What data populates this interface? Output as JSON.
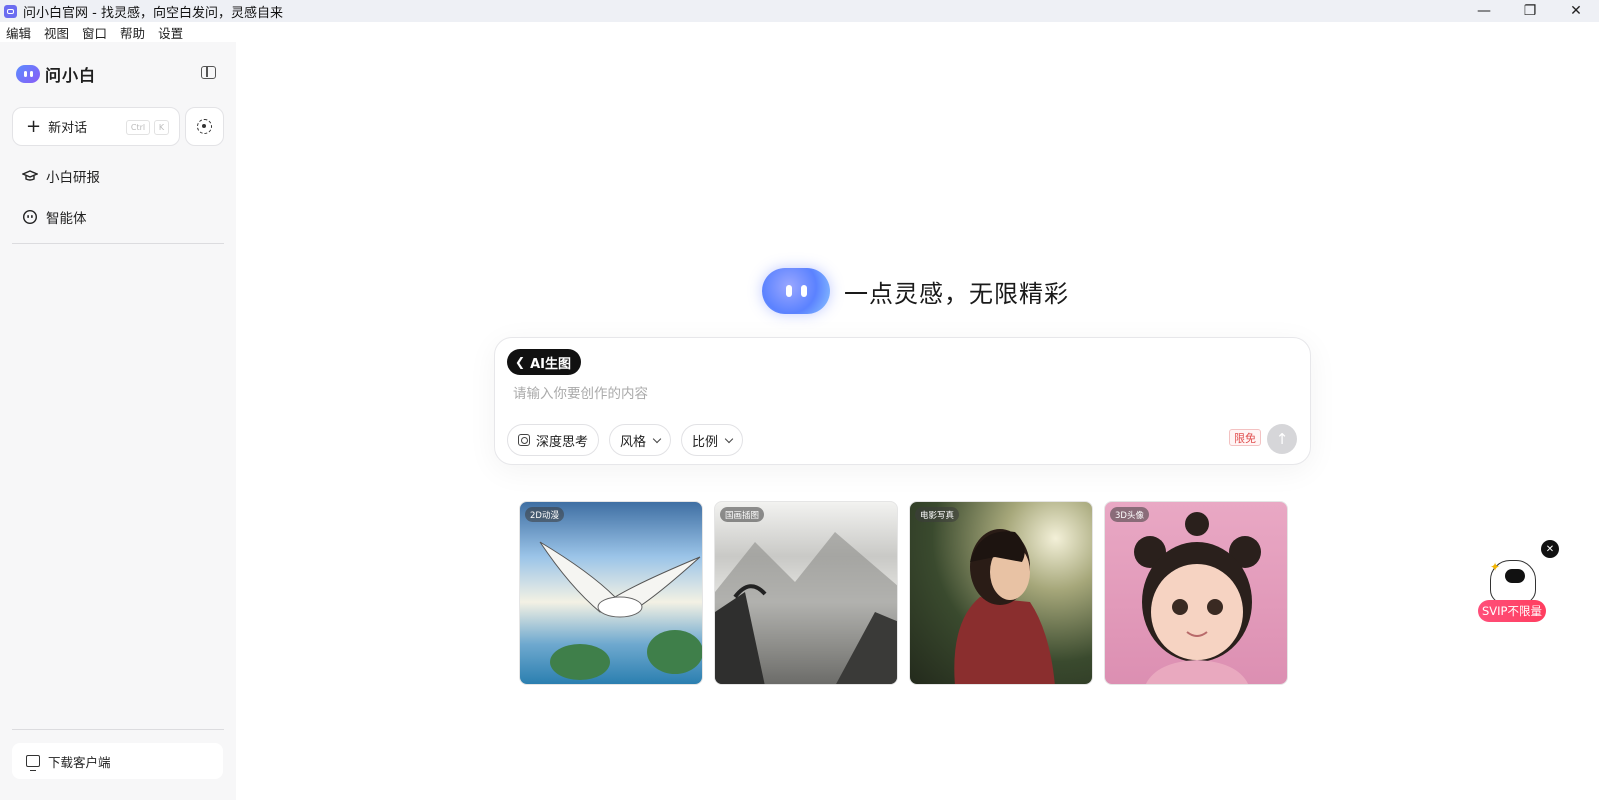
{
  "window": {
    "title": "问小白官网 - 找灵感，向空白发问，灵感自来",
    "controls": {
      "minimize": "—",
      "restore": "❐",
      "close": "✕"
    }
  },
  "menu": [
    "编辑",
    "视图",
    "窗口",
    "帮助",
    "设置"
  ],
  "sidebar": {
    "brand": "问小白",
    "new_chat": {
      "label": "新对话",
      "shortcut_ctrl": "Ctrl",
      "shortcut_key": "K"
    },
    "items": [
      {
        "label": "小白研报",
        "icon": "graduation-cap-icon"
      },
      {
        "label": "智能体",
        "icon": "bot-face-icon"
      }
    ],
    "download": "下载客户端"
  },
  "hero": {
    "slogan": "一点灵感，无限精彩"
  },
  "composer": {
    "mode": "AI生图",
    "placeholder": "请输入你要创作的内容",
    "deep_think": "深度思考",
    "style": "风格",
    "ratio": "比例",
    "free_badge": "限免"
  },
  "samples": [
    {
      "tag": "2D动漫",
      "scene": "seagull-over-sea"
    },
    {
      "tag": "国画插图",
      "scene": "ink-mountains"
    },
    {
      "tag": "电影写真",
      "scene": "portrait-woman"
    },
    {
      "tag": "3D头像",
      "scene": "cartoon-girl"
    }
  ],
  "promo": {
    "label": "SVIP不限量",
    "close": "✕"
  },
  "colors": {
    "accent": "#5b82ff",
    "svip": "#ff3d5f",
    "chip": "#111111"
  }
}
